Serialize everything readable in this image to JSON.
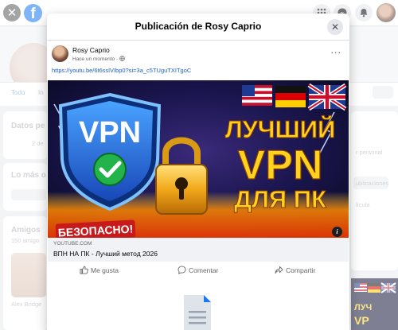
{
  "background": {
    "tabs": [
      "Todo",
      "In"
    ],
    "sections": [
      "Datos pe",
      "Lo más o",
      "Amigos"
    ],
    "friends_count": "150 amigo",
    "friend_name": "Alex Bridge",
    "detail_small": "2 de",
    "right_labels": [
      "r personal",
      "ublicaciones",
      "lícula"
    ]
  },
  "modal": {
    "title": "Publicación de Rosy Caprio",
    "close_symbol": "✕"
  },
  "post": {
    "author": "Rosy Caprio",
    "timestamp": "Hace un momento",
    "privacy_dot": "·",
    "link": "https://youtu.be/6t6sslVIbp0?si=3a_c5TUguTXITgoC",
    "more_symbol": "···"
  },
  "preview": {
    "domain": "YOUTUBE.COM",
    "title": "ВПН НА ПК - Лучший метод 2026",
    "thumbnail_text": {
      "vpn_shield": "VPN",
      "line1": "ЛУЧШИЙ",
      "line2": "VPN",
      "line3": "ДЛЯ ПК",
      "banner": "БЕЗОПАСНО!"
    },
    "info_symbol": "i"
  },
  "actions": {
    "like": "Me gusta",
    "comment": "Comentar",
    "share": "Compartir"
  },
  "colors": {
    "accent": "#1877f2",
    "link": "#1a5fc4",
    "headline_yellow": "#ffd21f",
    "vpn_blue": "#1e6be0"
  }
}
